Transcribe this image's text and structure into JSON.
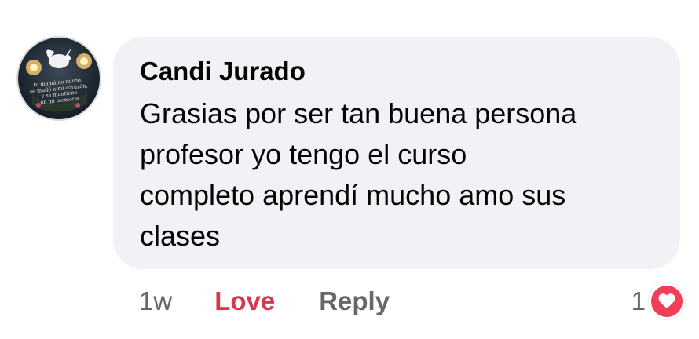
{
  "comment": {
    "author": "Candi Jurado",
    "text": "Grasias por ser tan buena persona\nprofesor yo tengo el curso\ncompleto aprendí mucho  amo sus\nclases",
    "avatar": {
      "icon": "memorial-dove-avatar",
      "caption": "tu mamá no murió,\nse mudó a mi corazón,\ny se mantiene\nen mi memoria"
    }
  },
  "actions": {
    "timestamp": "1w",
    "love_label": "Love",
    "reply_label": "Reply"
  },
  "reactions": {
    "count": "1",
    "icon": "heart-icon",
    "color": "#f33e58"
  },
  "colors": {
    "bubble": "#f0f2f5",
    "love_accent": "#d03a4c",
    "secondary_text": "#65676b"
  }
}
